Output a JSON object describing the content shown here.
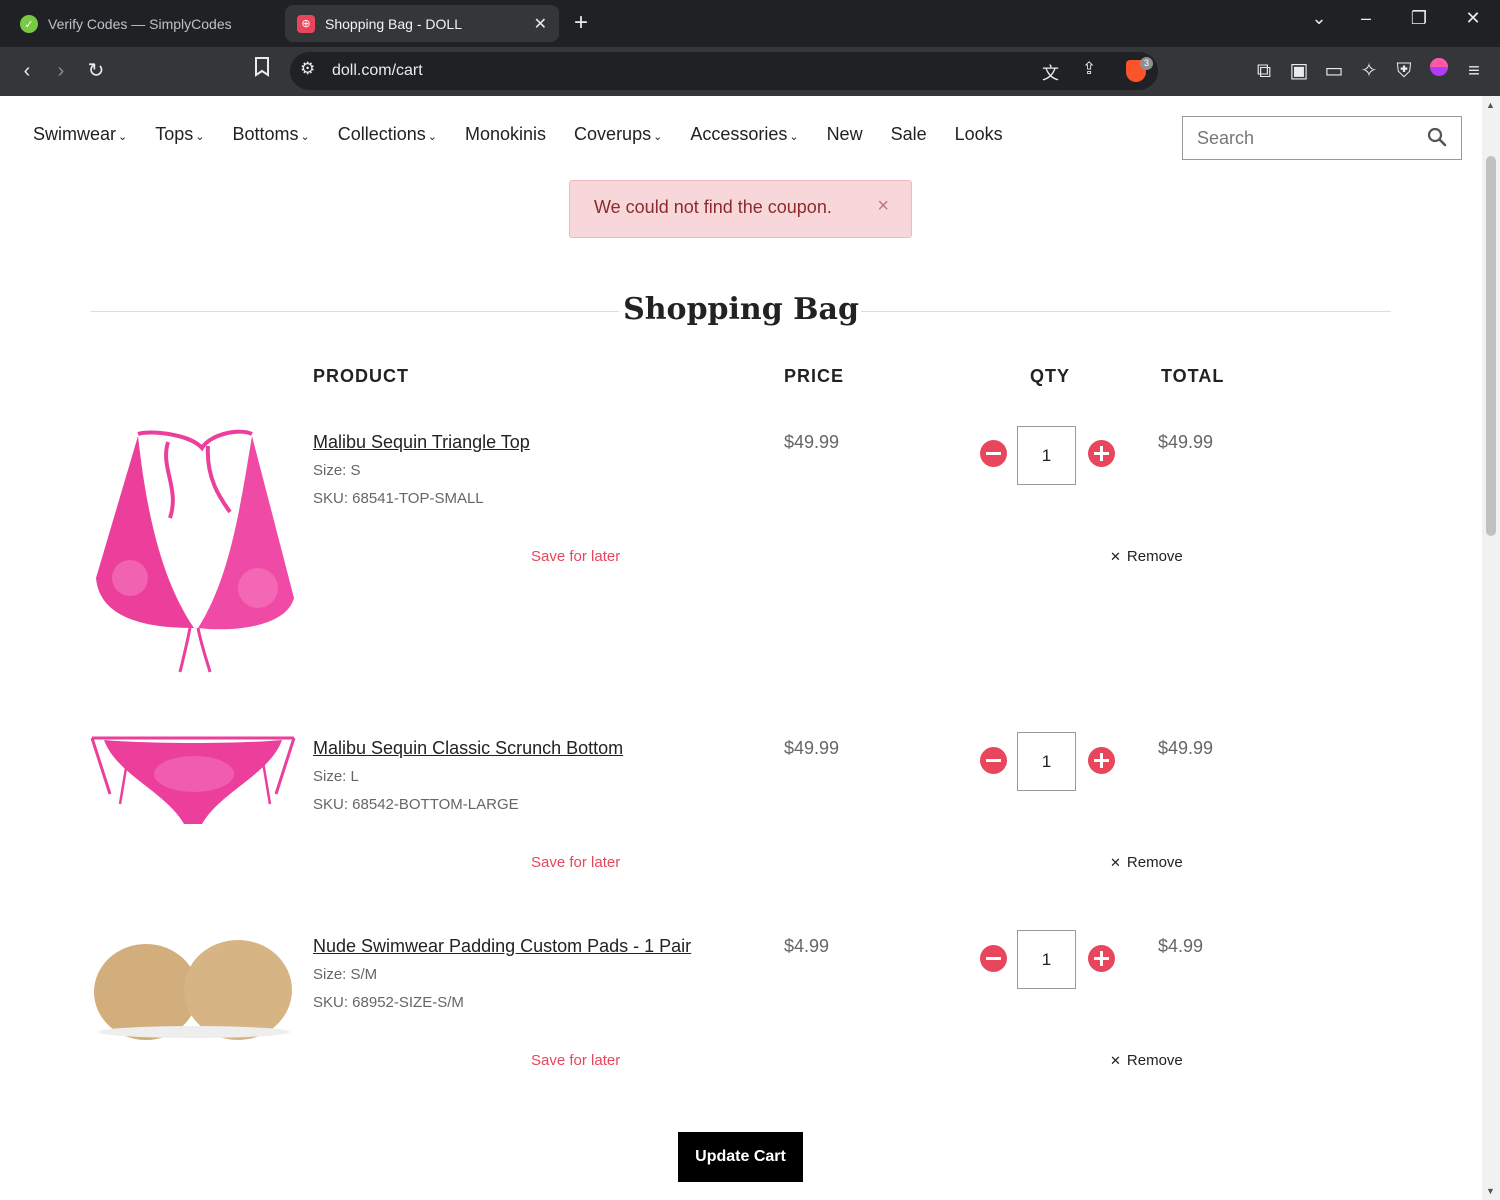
{
  "browser": {
    "tabs": [
      {
        "title": "Verify Codes — SimplyCodes",
        "active": false
      },
      {
        "title": "Shopping Bag - DOLL",
        "active": true
      }
    ],
    "url": "doll.com/cart",
    "brave_badge": "3"
  },
  "nav": {
    "items": [
      {
        "label": "Swimwear",
        "dropdown": true
      },
      {
        "label": "Tops",
        "dropdown": true
      },
      {
        "label": "Bottoms",
        "dropdown": true
      },
      {
        "label": "Collections",
        "dropdown": true
      },
      {
        "label": "Monokinis",
        "dropdown": false
      },
      {
        "label": "Coverups",
        "dropdown": true
      },
      {
        "label": "Accessories",
        "dropdown": true
      },
      {
        "label": "New",
        "dropdown": false
      },
      {
        "label": "Sale",
        "dropdown": false
      },
      {
        "label": "Looks",
        "dropdown": false
      }
    ],
    "search_placeholder": "Search"
  },
  "alert": {
    "message": "We could not find the coupon.",
    "close": "×"
  },
  "cart": {
    "title": "Shopping Bag",
    "headers": {
      "product": "PRODUCT",
      "price": "PRICE",
      "qty": "QTY",
      "total": "TOTAL"
    },
    "items": [
      {
        "name": "Malibu Sequin Triangle Top",
        "size": "Size: S",
        "sku": "SKU: 68541-TOP-SMALL",
        "price": "$49.99",
        "qty": "1",
        "total": "$49.99",
        "save_label": "Save for later",
        "remove_label": "Remove"
      },
      {
        "name": "Malibu Sequin Classic Scrunch Bottom",
        "size": "Size: L",
        "sku": "SKU: 68542-BOTTOM-LARGE",
        "price": "$49.99",
        "qty": "1",
        "total": "$49.99",
        "save_label": "Save for later",
        "remove_label": "Remove"
      },
      {
        "name": "Nude Swimwear Padding Custom Pads - 1 Pair",
        "size": "Size: S/M",
        "sku": "SKU: 68952-SIZE-S/M",
        "price": "$4.99",
        "qty": "1",
        "total": "$4.99",
        "save_label": "Save for later",
        "remove_label": "Remove"
      }
    ],
    "update_label": "Update Cart"
  },
  "colors": {
    "accent": "#e8465c",
    "alert_bg": "#f8d7da",
    "alert_text": "#8b2c2c",
    "product_pink": "#ec3f9c",
    "pad_beige": "#d1ae7b"
  }
}
